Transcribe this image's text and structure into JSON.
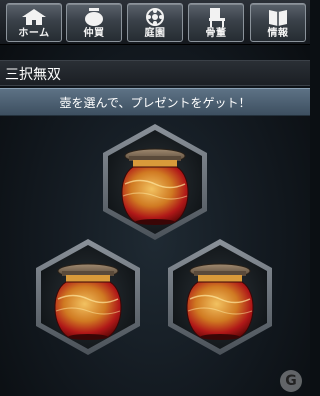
{
  "nav": {
    "items": [
      {
        "label": "ホーム",
        "icon": "home-icon"
      },
      {
        "label": "仲買",
        "icon": "pot-icon"
      },
      {
        "label": "庭園",
        "icon": "flower-icon"
      },
      {
        "label": "骨董",
        "icon": "chair-icon"
      },
      {
        "label": "情報",
        "icon": "book-icon"
      }
    ]
  },
  "page": {
    "title": "三択無双"
  },
  "instruction": "壺を選んで、プレゼントをゲット！",
  "pots": [
    {
      "icon": "jar-icon"
    },
    {
      "icon": "jar-icon"
    },
    {
      "icon": "jar-icon"
    }
  ],
  "colors": {
    "instruction_bar": "#4e6376",
    "jar_red": "#b01818",
    "jar_gold": "#e0a040"
  }
}
